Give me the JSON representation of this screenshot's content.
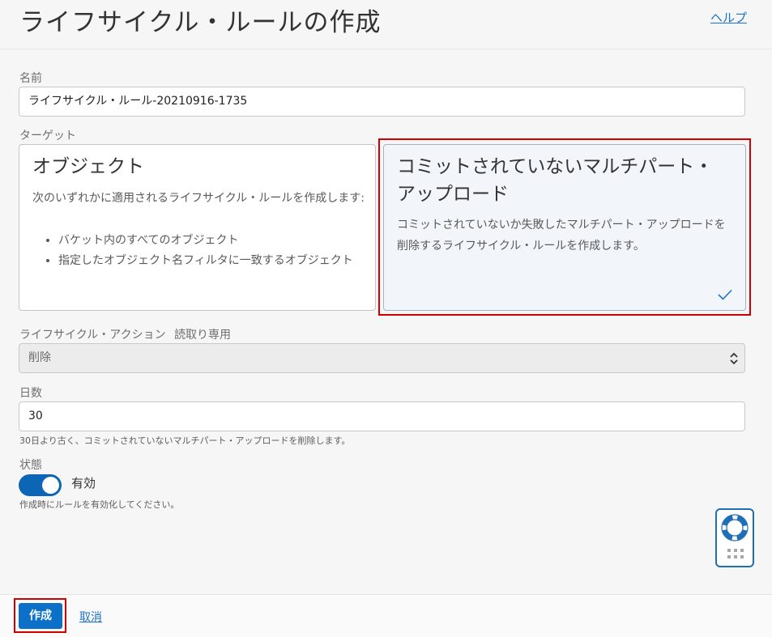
{
  "header": {
    "title": "ライフサイクル・ルールの作成",
    "help_link": "ヘルプ"
  },
  "form": {
    "name": {
      "label": "名前",
      "value": "ライフサイクル・ルール-20210916-1735"
    },
    "target": {
      "label": "ターゲット",
      "object_card": {
        "title": "オブジェクト",
        "description": "次のいずれかに適用されるライフサイクル・ルールを作成します:",
        "bullets": [
          "バケット内のすべてのオブジェクト",
          "指定したオブジェクト名フィルタに一致するオブジェクト"
        ]
      },
      "multipart_card": {
        "title": "コミットされていないマルチパート・アップロード",
        "description": "コミットされていないか失敗したマルチパート・アップロードを削除するライフサイクル・ルールを作成します。",
        "selected": true
      }
    },
    "action": {
      "label": "ライフサイクル・アクション",
      "readonly_note": "読取り専用",
      "value": "削除"
    },
    "days": {
      "label": "日数",
      "value": "30",
      "help": "30日より古く、コミットされていないマルチパート・アップロードを削除します。"
    },
    "state": {
      "label": "状態",
      "toggle_label": "有効",
      "enabled": true,
      "help": "作成時にルールを有効化してください。"
    }
  },
  "footer": {
    "create_button": "作成",
    "cancel_link": "取消"
  },
  "colors": {
    "accent": "#0c70c9",
    "highlight_border": "#d00000"
  },
  "icons": {
    "help_widget": "lifebuoy-icon",
    "selected": "check-icon",
    "select": "updown-arrows-icon"
  }
}
